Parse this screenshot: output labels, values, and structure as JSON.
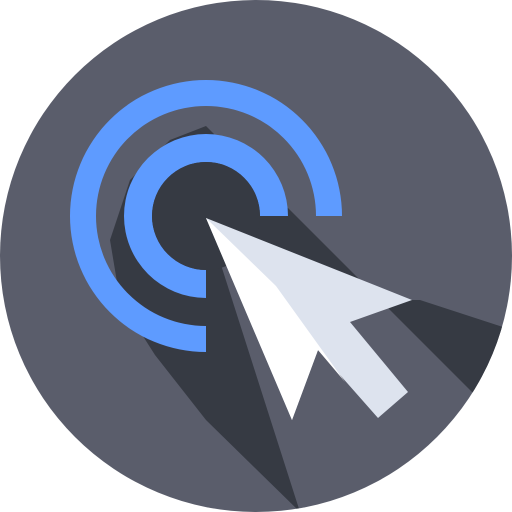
{
  "icon": {
    "name": "click-cursor-icon",
    "colors": {
      "background_circle": "#5a5d6b",
      "long_shadow": "#363a43",
      "ring_blue": "#5e9bff",
      "ring_blue_highlight": "#6aaeff",
      "cursor_light": "#dde3ee",
      "cursor_white": "#ffffff"
    }
  }
}
